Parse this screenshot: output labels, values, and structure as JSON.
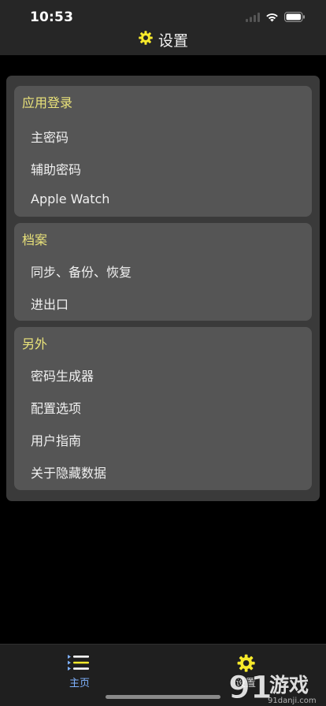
{
  "status_bar": {
    "time": "10:53"
  },
  "header": {
    "title": "设置",
    "icon": "gear-icon"
  },
  "sections": [
    {
      "title": "应用登录",
      "items": [
        "主密码",
        "辅助密码",
        "Apple Watch"
      ]
    },
    {
      "title": "档案",
      "items": [
        "同步、备份、恢复",
        "进出口"
      ]
    },
    {
      "title": "另外",
      "items": [
        "密码生成器",
        "配置选项",
        "用户指南",
        "关于隐藏数据"
      ]
    }
  ],
  "tab_bar": {
    "tabs": [
      {
        "label": "主页",
        "icon": "list-icon",
        "active": true
      },
      {
        "label": "设置",
        "icon": "gear-icon",
        "active": false
      }
    ]
  },
  "watermark": {
    "brand": "游戏",
    "numeral": "91",
    "url": "91danji.com"
  },
  "colors": {
    "accent": "#f7ea2b",
    "section_title": "#eae37a",
    "tab_active": "#7fb2ff",
    "background": "#000000"
  }
}
